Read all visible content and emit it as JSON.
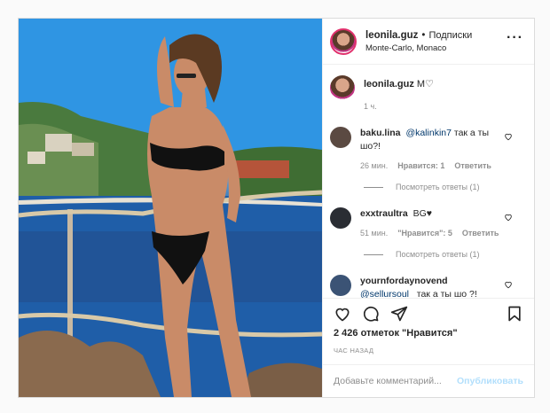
{
  "header": {
    "username": "leonila.guz",
    "separator": "•",
    "follow": "Подписки",
    "location": "Monte-Carlo, Monaco",
    "more_icon": "more-horizontal-icon"
  },
  "caption": {
    "username": "leonila.guz",
    "text": "M♡",
    "time": "1 ч."
  },
  "comments": [
    {
      "username": "baku.lina",
      "mention": "@kalinkin7",
      "text": "так а ты шо?!",
      "time": "26 мин.",
      "likes": "Нравится: 1",
      "reply": "Ответить",
      "view_replies": "Посмотреть ответы (1)",
      "avatar_color": "#5b4a42"
    },
    {
      "username": "exxtraultra",
      "mention": "",
      "text": "BG♥",
      "time": "51 мин.",
      "likes": "\"Нравится\": 5",
      "reply": "Ответить",
      "view_replies": "Посмотреть ответы (1)",
      "avatar_color": "#2a2d33"
    },
    {
      "username": "yournfordaynovend",
      "mention": "@sellursoul_",
      "text": "так а ты шо ?!",
      "avatar_color": "#3b5375"
    }
  ],
  "actions": {
    "like_icon": "heart-icon",
    "comment_icon": "comment-icon",
    "share_icon": "share-icon",
    "save_icon": "bookmark-icon"
  },
  "likes_text": "2 426 отметок \"Нравится\"",
  "posted_ago": "ЧАС НАЗАД",
  "add_comment": {
    "placeholder": "Добавьте комментарий...",
    "publish": "Опубликовать"
  },
  "colors": {
    "mention": "#00376b",
    "muted": "#8e8e8e",
    "publish_disabled": "#b2dffc"
  }
}
